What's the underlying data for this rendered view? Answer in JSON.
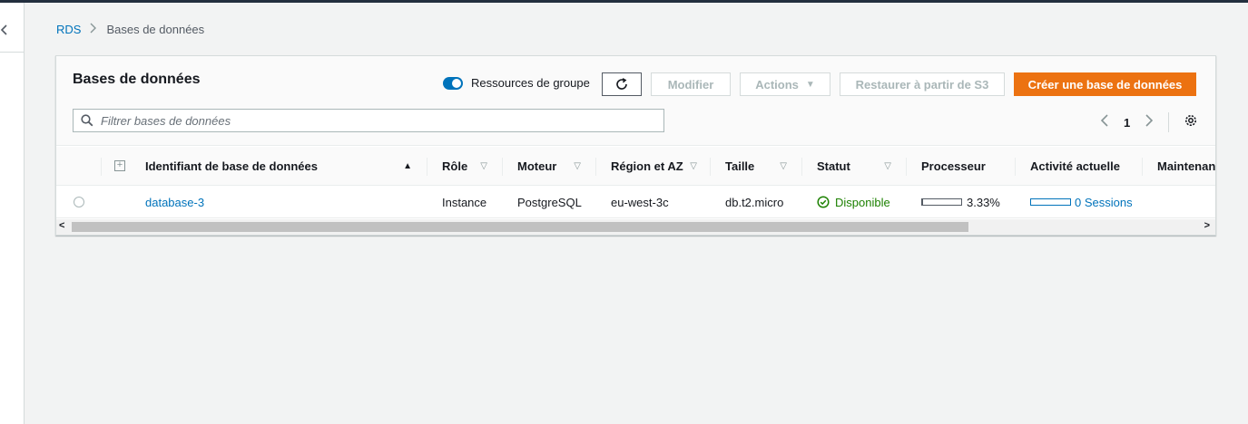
{
  "breadcrumb": {
    "root": "RDS",
    "current": "Bases de données"
  },
  "panel": {
    "title": "Bases de données",
    "group_toggle_label": "Ressources de groupe",
    "buttons": {
      "modify": "Modifier",
      "actions": "Actions",
      "restore": "Restaurer à partir de S3",
      "create": "Créer une base de données"
    },
    "search_placeholder": "Filtrer bases de données",
    "page_number": "1"
  },
  "table": {
    "columns": [
      "Identifiant de base de données",
      "Rôle",
      "Moteur",
      "Région et AZ",
      "Taille",
      "Statut",
      "Processeur",
      "Activité actuelle",
      "Maintenanc"
    ],
    "rows": [
      {
        "identifier": "database-3",
        "role": "Instance",
        "engine": "PostgreSQL",
        "region": "eu-west-3c",
        "size": "db.t2.micro",
        "status": "Disponible",
        "cpu": "3.33%",
        "cpu_fraction": 0.0333,
        "activity": "0 Sessions",
        "activity_fraction": 0
      }
    ]
  },
  "colors": {
    "accent_link": "#0073bb",
    "primary_button": "#ec7211",
    "status_ok": "#1d8102"
  }
}
